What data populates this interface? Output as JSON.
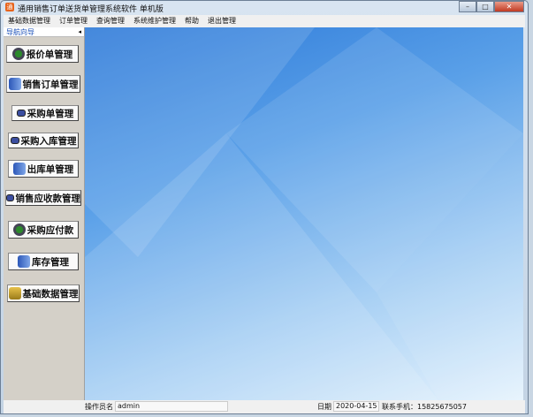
{
  "window": {
    "title": "通用销售订单送货单管理系统软件   单机版",
    "app_icon": "app-icon",
    "controls": {
      "minimize": "–",
      "maximize": "□",
      "close": "✕"
    }
  },
  "menu": [
    "基础数据管理",
    "订单管理",
    "查询管理",
    "系统维护管理",
    "帮助",
    "退出管理"
  ],
  "nav": {
    "header": "导航向导",
    "collapse": "◂",
    "buttons": [
      {
        "label": "报价单管理",
        "icon": "money-bag-icon"
      },
      {
        "label": "销售订单管理",
        "icon": "book-edit-icon"
      },
      {
        "label": "采购单管理",
        "icon": "window-icon"
      },
      {
        "label": "采购入库管理",
        "icon": "window-icon"
      },
      {
        "label": "出库单管理",
        "icon": "book-edit-icon"
      },
      {
        "label": "销售应收款管理",
        "icon": "window-icon"
      },
      {
        "label": "采购应付款",
        "icon": "money-bag-icon"
      },
      {
        "label": "库存管理",
        "icon": "book-edit-icon"
      },
      {
        "label": "基础数据管理",
        "icon": "database-icon"
      }
    ]
  },
  "status": {
    "operator_label": "操作员名",
    "operator": "admin",
    "date_label": "日期",
    "date": "2020-04-15",
    "phone": "联系手机：15825675057"
  }
}
